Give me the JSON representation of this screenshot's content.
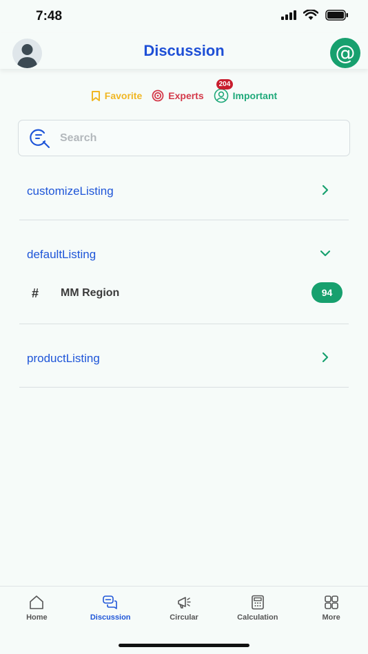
{
  "status_bar": {
    "time": "7:48"
  },
  "header": {
    "title": "Discussion",
    "mention_symbol": "@"
  },
  "filters": [
    {
      "label": "Favorite",
      "color": "#f0b623"
    },
    {
      "label": "Experts",
      "color": "#d43a4a"
    },
    {
      "label": "Important",
      "color": "#1fa97a",
      "badge": "204"
    }
  ],
  "search": {
    "placeholder": "Search"
  },
  "sections": [
    {
      "title": "customizeListing",
      "expanded": false
    },
    {
      "title": "defaultListing",
      "expanded": true,
      "channels": [
        {
          "symbol": "#",
          "name": "MM Region",
          "count": "94"
        }
      ]
    },
    {
      "title": "productListing",
      "expanded": false
    }
  ],
  "tabs": [
    {
      "label": "Home",
      "icon": "home-icon",
      "active": false
    },
    {
      "label": "Discussion",
      "icon": "discussion-icon",
      "active": true
    },
    {
      "label": "Circular",
      "icon": "megaphone-icon",
      "active": false
    },
    {
      "label": "Calculation",
      "icon": "calculator-icon",
      "active": false
    },
    {
      "label": "More",
      "icon": "grid-icon",
      "active": false
    }
  ],
  "colors": {
    "brand_blue": "#1e4fd6",
    "accent_green": "#17a06e",
    "badge_red": "#c81e2e"
  }
}
